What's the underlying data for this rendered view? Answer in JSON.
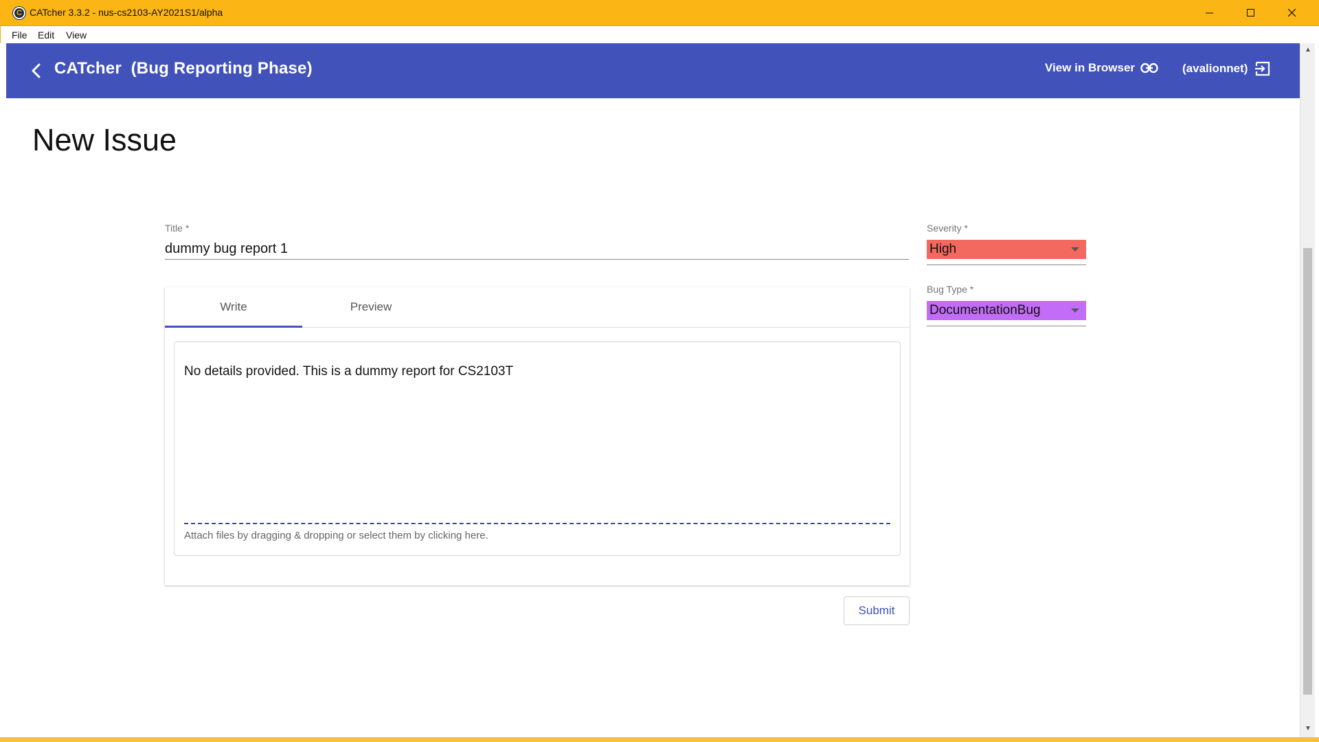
{
  "window": {
    "title": "CATcher 3.3.2 - nus-cs2103-AY2021S1/alpha",
    "app_icon_glyph": "C"
  },
  "menubar": {
    "items": [
      "File",
      "Edit",
      "View"
    ]
  },
  "appbar": {
    "title": "CATcher  (Bug Reporting Phase)",
    "view_in_browser": "View in Browser",
    "user": "(avalionnet)",
    "color": "#4152ba"
  },
  "page": {
    "title": "New Issue"
  },
  "form": {
    "title_label": "Title *",
    "title_value": "dummy bug report 1",
    "tabs": [
      "Write",
      "Preview"
    ],
    "active_tab": "Write",
    "description": "No details provided. This is a dummy report for CS2103T",
    "attach_hint": "Attach files by dragging & dropping or select them by clicking here.",
    "submit_label": "Submit",
    "severity_label": "Severity *",
    "severity_value": "High",
    "severity_color": "#f3685f",
    "bug_type_label": "Bug Type *",
    "bug_type_value": "DocumentationBug",
    "bug_type_color": "#c36cf7"
  },
  "icons": {
    "back": "chevron-left-icon",
    "link": "link-icon",
    "logout": "exit-icon",
    "dropdown": "dropdown-arrow-icon"
  }
}
